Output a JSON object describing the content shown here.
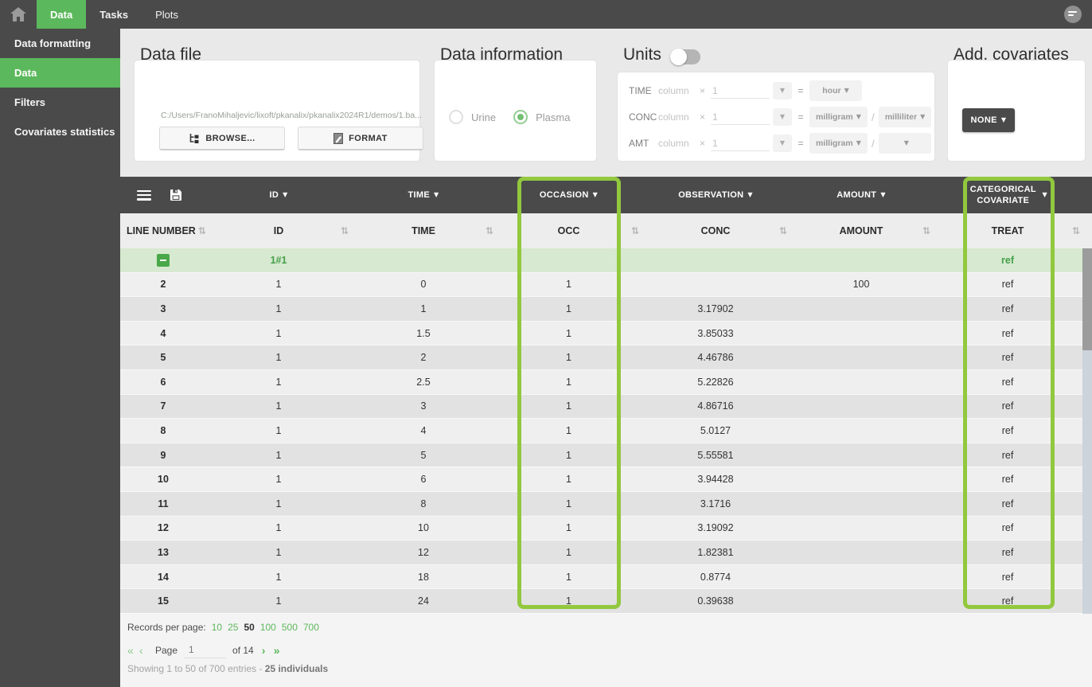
{
  "nav": {
    "tabs": [
      {
        "label": "Data",
        "active": true
      },
      {
        "label": "Tasks",
        "active": false
      },
      {
        "label": "Plots",
        "active": false
      }
    ]
  },
  "sidebar": {
    "items": [
      {
        "label": "Data formatting",
        "active": false
      },
      {
        "label": "Data",
        "active": true
      },
      {
        "label": "Filters",
        "active": false
      },
      {
        "label": "Covariates statistics",
        "active": false
      }
    ]
  },
  "panels": {
    "data_file": {
      "title": "Data file",
      "path": "C:/Users/FranoMihaljevic/lixoft/pkanalix/pkanalix2024R1/demos/1.ba...",
      "browse_label": "BROWSE...",
      "format_label": "FORMAT"
    },
    "data_information": {
      "title": "Data information",
      "options": [
        {
          "label": "Urine",
          "selected": false
        },
        {
          "label": "Plasma",
          "selected": true
        }
      ]
    },
    "units": {
      "title": "Units",
      "toggle_on": false,
      "rows": [
        {
          "label": "TIME",
          "placeholder": "column",
          "times": "×",
          "factor": "1",
          "equals": "=",
          "numerator": "hour",
          "slash": "",
          "denominator": ""
        },
        {
          "label": "CONC",
          "placeholder": "column",
          "times": "×",
          "factor": "1",
          "equals": "=",
          "numerator": "milligram",
          "slash": "/",
          "denominator": "milliliter"
        },
        {
          "label": "AMT",
          "placeholder": "column",
          "times": "×",
          "factor": "1",
          "equals": "=",
          "numerator": "milligram",
          "slash": "/",
          "denominator": ""
        }
      ]
    },
    "add_covariates": {
      "title": "Add. covariates",
      "button_label": "NONE"
    }
  },
  "table": {
    "header_dropdowns": [
      "ID",
      "TIME",
      "OCCASION",
      "OBSERVATION",
      "AMOUNT",
      "CATEGORICAL COVARIATE"
    ],
    "columns": [
      "LINE NUMBER",
      "ID",
      "TIME",
      "OCC",
      "CONC",
      "AMOUNT",
      "TREAT"
    ],
    "highlighted_columns": [
      "OCC",
      "TREAT"
    ],
    "group_row": {
      "id": "1#1",
      "treat": "ref"
    },
    "rows": [
      {
        "line": "2",
        "id": "1",
        "time": "0",
        "occ": "1",
        "conc": "",
        "amount": "100",
        "treat": "ref"
      },
      {
        "line": "3",
        "id": "1",
        "time": "1",
        "occ": "1",
        "conc": "3.17902",
        "amount": "",
        "treat": "ref"
      },
      {
        "line": "4",
        "id": "1",
        "time": "1.5",
        "occ": "1",
        "conc": "3.85033",
        "amount": "",
        "treat": "ref"
      },
      {
        "line": "5",
        "id": "1",
        "time": "2",
        "occ": "1",
        "conc": "4.46786",
        "amount": "",
        "treat": "ref"
      },
      {
        "line": "6",
        "id": "1",
        "time": "2.5",
        "occ": "1",
        "conc": "5.22826",
        "amount": "",
        "treat": "ref"
      },
      {
        "line": "7",
        "id": "1",
        "time": "3",
        "occ": "1",
        "conc": "4.86716",
        "amount": "",
        "treat": "ref"
      },
      {
        "line": "8",
        "id": "1",
        "time": "4",
        "occ": "1",
        "conc": "5.0127",
        "amount": "",
        "treat": "ref"
      },
      {
        "line": "9",
        "id": "1",
        "time": "5",
        "occ": "1",
        "conc": "5.55581",
        "amount": "",
        "treat": "ref"
      },
      {
        "line": "10",
        "id": "1",
        "time": "6",
        "occ": "1",
        "conc": "3.94428",
        "amount": "",
        "treat": "ref"
      },
      {
        "line": "11",
        "id": "1",
        "time": "8",
        "occ": "1",
        "conc": "3.1716",
        "amount": "",
        "treat": "ref"
      },
      {
        "line": "12",
        "id": "1",
        "time": "10",
        "occ": "1",
        "conc": "3.19092",
        "amount": "",
        "treat": "ref"
      },
      {
        "line": "13",
        "id": "1",
        "time": "12",
        "occ": "1",
        "conc": "1.82381",
        "amount": "",
        "treat": "ref"
      },
      {
        "line": "14",
        "id": "1",
        "time": "18",
        "occ": "1",
        "conc": "0.8774",
        "amount": "",
        "treat": "ref"
      },
      {
        "line": "15",
        "id": "1",
        "time": "24",
        "occ": "1",
        "conc": "0.39638",
        "amount": "",
        "treat": "ref"
      }
    ]
  },
  "footer": {
    "records_label": "Records per page:",
    "page_sizes": [
      "10",
      "25",
      "50",
      "100",
      "500",
      "700"
    ],
    "active_page_size": "50",
    "first_arrow": "«",
    "prev_arrow": "‹",
    "page_label": "Page",
    "page_value": "1",
    "of_label": "of 14",
    "next_arrow": "›",
    "last_arrow": "»",
    "showing_text": "Showing 1 to 50 of 700 entries - ",
    "individuals_text": "25 individuals"
  },
  "colors": {
    "accent_green": "#5cb85c",
    "highlight_green": "#92c83e",
    "dark_gray": "#4a4a4a",
    "group_row_green": "#d7e9d0"
  }
}
